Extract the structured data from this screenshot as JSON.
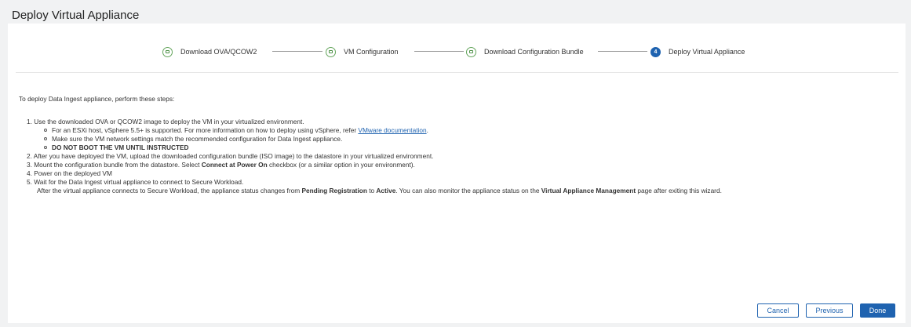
{
  "page": {
    "title": "Deploy Virtual Appliance"
  },
  "stepper": {
    "steps": [
      {
        "label": "Download OVA/QCOW2",
        "state": "completed",
        "icon": "check-square-icon"
      },
      {
        "label": "VM Configuration",
        "state": "completed",
        "icon": "check-square-icon"
      },
      {
        "label": "Download Configuration Bundle",
        "state": "completed",
        "icon": "check-square-icon"
      },
      {
        "label": "Deploy Virtual Appliance",
        "state": "active",
        "number": "4"
      }
    ]
  },
  "content": {
    "intro": "To deploy Data Ingest appliance, perform these steps:",
    "step1": {
      "number": "1.",
      "text": "Use the downloaded OVA or QCOW2 image to deploy the VM in your virtualized environment.",
      "bullets": {
        "b1_prefix": "For an ESXi host, vSphere 5.5+ is supported. For more information on how to deploy using vSphere, refer ",
        "b1_link": "VMware documentation",
        "b1_suffix": ".",
        "b2": "Make sure the VM network settings match the recommended configuration for Data Ingest appliance.",
        "b3": "DO NOT BOOT THE VM UNTIL INSTRUCTED"
      }
    },
    "step2": {
      "number": "2.",
      "text": "After you have deployed the VM, upload the downloaded configuration bundle (ISO image) to the datastore in your virtualized environment."
    },
    "step3": {
      "number": "3.",
      "text_a": "Mount the configuration bundle from the datastore. Select ",
      "bold": "Connect at Power On",
      "text_b": " checkbox (or a similar option in your environment)."
    },
    "step4": {
      "number": "4.",
      "text": "Power on the deployed VM"
    },
    "step5": {
      "number": "5.",
      "text": "Wait for the Data Ingest virtual appliance to connect to Secure Workload.",
      "detail_a": "After the virtual appliance connects to Secure Workload, the appliance status changes from ",
      "bold_1": "Pending Registration",
      "detail_b": " to ",
      "bold_2": "Active",
      "detail_c": ". You can also monitor the appliance status on the ",
      "bold_3": "Virtual Appliance Management",
      "detail_d": " page after exiting this wizard."
    }
  },
  "footer": {
    "cancel": "Cancel",
    "previous": "Previous",
    "done": "Done"
  },
  "colors": {
    "accent": "#1f63b0",
    "completed": "#64a55c"
  }
}
